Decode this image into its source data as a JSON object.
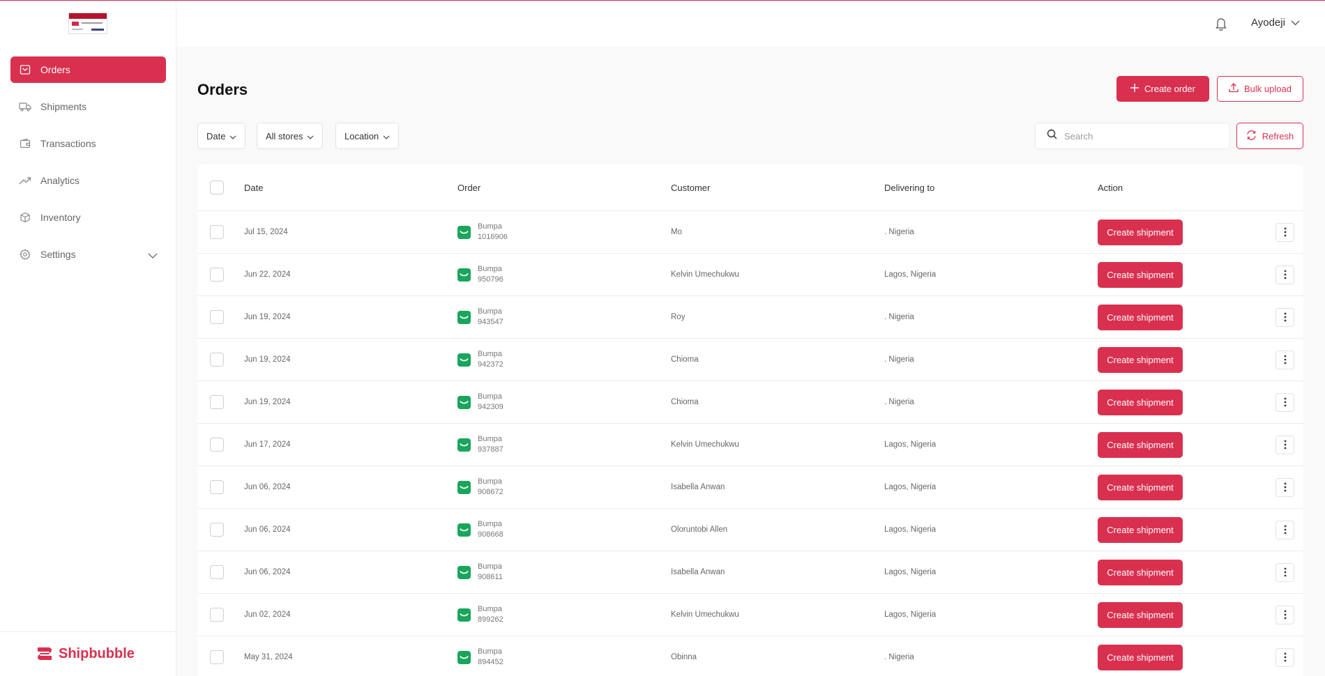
{
  "header": {
    "user_name": "Ayodeji"
  },
  "sidebar": {
    "items": [
      {
        "label": "Orders",
        "icon": "orders-icon",
        "active": true
      },
      {
        "label": "Shipments",
        "icon": "truck-icon"
      },
      {
        "label": "Transactions",
        "icon": "wallet-icon"
      },
      {
        "label": "Analytics",
        "icon": "trend-icon"
      },
      {
        "label": "Inventory",
        "icon": "box-icon"
      },
      {
        "label": "Settings",
        "icon": "gear-icon"
      }
    ],
    "brand_part1": "Ship",
    "brand_part2": "bubble"
  },
  "page": {
    "title": "Orders",
    "create_order_label": "Create order",
    "bulk_upload_label": "Bulk upload",
    "filters": {
      "date": "Date",
      "stores": "All stores",
      "location": "Location"
    },
    "search_placeholder": "Search",
    "refresh_label": "Refresh"
  },
  "table": {
    "headers": {
      "date": "Date",
      "order": "Order",
      "customer": "Customer",
      "delivering_to": "Delivering to",
      "action": "Action"
    },
    "action_label": "Create shipment",
    "rows": [
      {
        "date": "Jul 15, 2024",
        "store": "Bumpa",
        "order_id": "1016906",
        "customer": "Mo",
        "city_mark": ".",
        "delivering_to": " Nigeria"
      },
      {
        "date": "Jun 22, 2024",
        "store": "Bumpa",
        "order_id": "950796",
        "customer": "Kelvin Umechukwu",
        "city_mark": "",
        "delivering_to": "Lagos, Nigeria"
      },
      {
        "date": "Jun 19, 2024",
        "store": "Bumpa",
        "order_id": "943547",
        "customer": "Roy",
        "city_mark": ".",
        "delivering_to": " Nigeria"
      },
      {
        "date": "Jun 19, 2024",
        "store": "Bumpa",
        "order_id": "942372",
        "customer": "Chioma",
        "city_mark": ".",
        "delivering_to": " Nigeria"
      },
      {
        "date": "Jun 19, 2024",
        "store": "Bumpa",
        "order_id": "942309",
        "customer": "Chioma",
        "city_mark": ".",
        "delivering_to": " Nigeria"
      },
      {
        "date": "Jun 17, 2024",
        "store": "Bumpa",
        "order_id": "937887",
        "customer": "Kelvin Umechukwu",
        "city_mark": "",
        "delivering_to": "Lagos, Nigeria"
      },
      {
        "date": "Jun 06, 2024",
        "store": "Bumpa",
        "order_id": "908672",
        "customer": "Isabella Anwan",
        "city_mark": "",
        "delivering_to": "Lagos, Nigeria"
      },
      {
        "date": "Jun 06, 2024",
        "store": "Bumpa",
        "order_id": "908668",
        "customer": "Oloruntobi Allen",
        "city_mark": "",
        "delivering_to": "Lagos, Nigeria"
      },
      {
        "date": "Jun 06, 2024",
        "store": "Bumpa",
        "order_id": "908611",
        "customer": "Isabella Anwan",
        "city_mark": "",
        "delivering_to": "Lagos, Nigeria"
      },
      {
        "date": "Jun 02, 2024",
        "store": "Bumpa",
        "order_id": "899262",
        "customer": "Kelvin Umechukwu",
        "city_mark": "",
        "delivering_to": "Lagos, Nigeria"
      },
      {
        "date": "May 31, 2024",
        "store": "Bumpa",
        "order_id": "894452",
        "customer": "Obinna",
        "city_mark": ".",
        "delivering_to": " Nigeria"
      }
    ]
  },
  "colors": {
    "accent": "#d9304f",
    "store_green": "#1aa55c"
  }
}
